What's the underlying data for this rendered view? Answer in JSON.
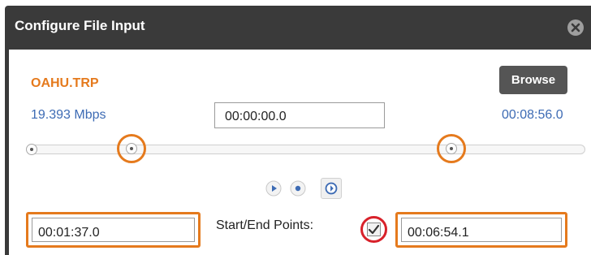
{
  "dialog": {
    "title": "Configure File Input",
    "close_icon": "close-circle-icon"
  },
  "file": {
    "name": "OAHU.TRP",
    "browse_label": "Browse",
    "bitrate": "19.393 Mbps",
    "current_time": "00:00:00.0",
    "duration": "00:08:56.0"
  },
  "scrubber": {
    "start_fraction": 0.18,
    "end_fraction": 0.77,
    "position_fraction": 0.0
  },
  "controls": {
    "play_icon": "play-icon",
    "stop_icon": "stop-icon",
    "snap_icon": "set-point-icon"
  },
  "points": {
    "label": "Start/End Points:",
    "start": "00:01:37.0",
    "end": "00:06:54.1",
    "enabled": true
  },
  "colors": {
    "accent_orange": "#e57a1d",
    "link_blue": "#3d6bb4",
    "highlight_red": "#d8212a",
    "title_bar": "#3a3a3a"
  }
}
